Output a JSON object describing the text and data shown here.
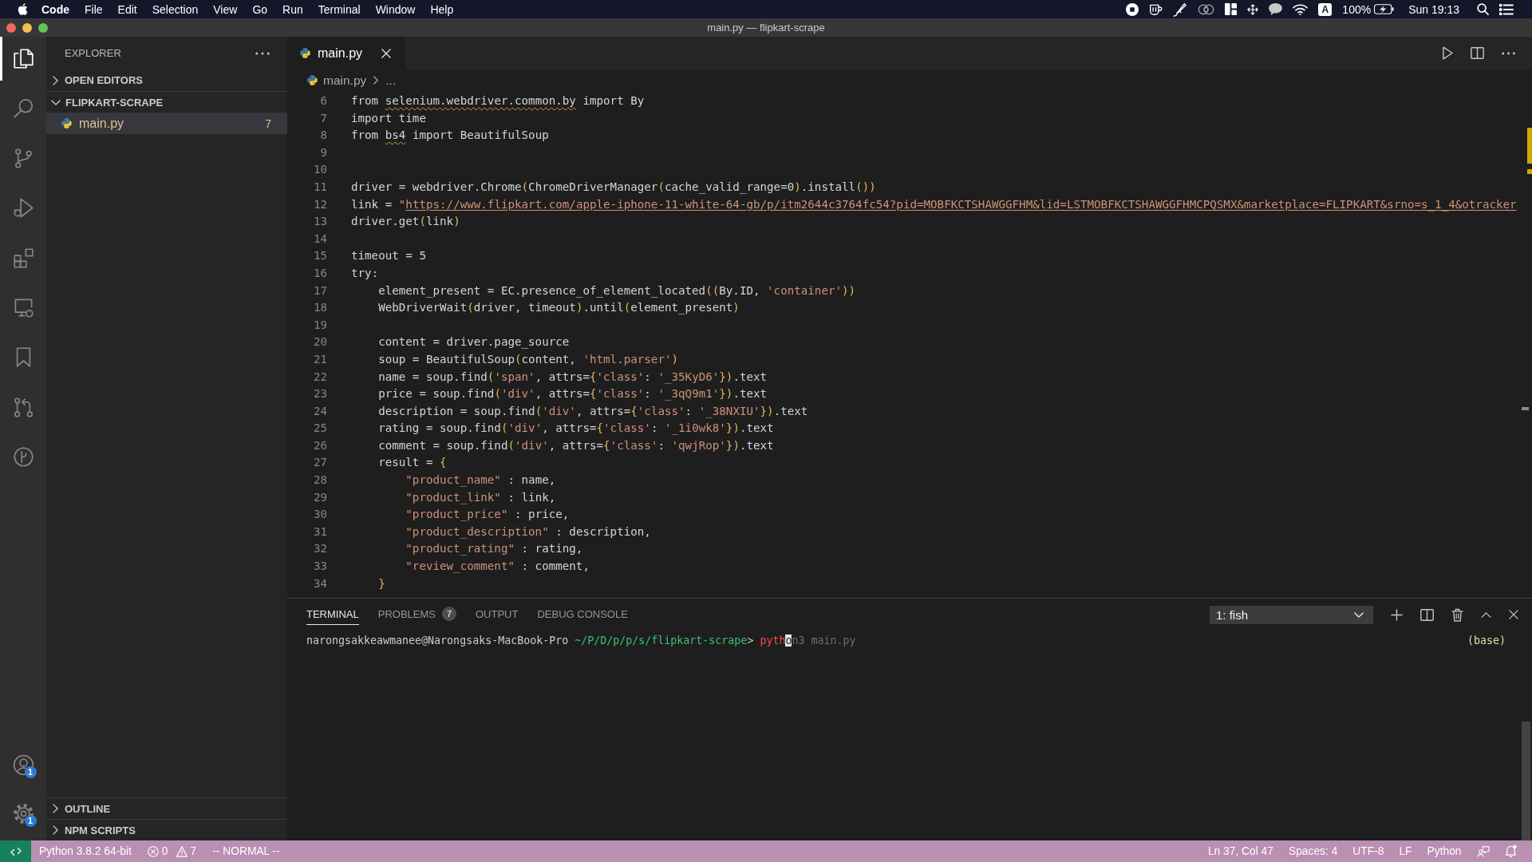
{
  "menu_bar": {
    "app_name": "Code",
    "menus": [
      "File",
      "Edit",
      "Selection",
      "View",
      "Go",
      "Run",
      "Terminal",
      "Window",
      "Help"
    ],
    "input_source": "A",
    "battery": "100%",
    "clock": "Sun 19:13"
  },
  "window": {
    "title": "main.py — flipkart-scrape"
  },
  "activity_bar": {
    "items": [
      {
        "kind": "explorer",
        "selected": true
      },
      {
        "kind": "search",
        "selected": false
      },
      {
        "kind": "source-control",
        "selected": false
      },
      {
        "kind": "run",
        "selected": false
      },
      {
        "kind": "extensions",
        "selected": false
      },
      {
        "kind": "remote",
        "selected": false
      },
      {
        "kind": "bookmarks",
        "selected": false
      },
      {
        "kind": "pull-requests",
        "selected": false
      },
      {
        "kind": "timeline",
        "selected": false
      }
    ],
    "bottom_items": [
      {
        "kind": "accounts",
        "badge": "1"
      },
      {
        "kind": "manage",
        "badge": "1"
      }
    ]
  },
  "sidebar": {
    "title": "EXPLORER",
    "sections": [
      {
        "title": "OPEN EDITORS",
        "expanded": false
      },
      {
        "title": "FLIPKART-SCRAPE",
        "expanded": true,
        "files": [
          {
            "name": "main.py",
            "selected": true,
            "warning": true,
            "problems": "7"
          }
        ]
      },
      {
        "title": "OUTLINE",
        "expanded": false
      },
      {
        "title": "NPM SCRIPTS",
        "expanded": false
      }
    ]
  },
  "editor": {
    "tabs": [
      {
        "label": "main.py",
        "selected": true
      }
    ],
    "breadcrumbs": [
      "main.py",
      "..."
    ],
    "lines": [
      {
        "number": "6",
        "tokens": [
          {
            "text": "from ",
            "kind": "plain"
          },
          {
            "text": "selenium.webdriver.common.by",
            "kind": "squiggle"
          },
          {
            "text": " import By",
            "kind": "plain"
          }
        ]
      },
      {
        "number": "7",
        "tokens": [
          {
            "text": "import time",
            "kind": "plain"
          }
        ]
      },
      {
        "number": "8",
        "tokens": [
          {
            "text": "from ",
            "kind": "plain"
          },
          {
            "text": "bs4",
            "kind": "squiggle"
          },
          {
            "text": " import BeautifulSoup",
            "kind": "plain"
          }
        ]
      },
      {
        "number": "9"
      },
      {
        "number": "10"
      },
      {
        "number": "11",
        "tokens": [
          {
            "text": "driver = webdriver.Chrome",
            "kind": "plain"
          },
          {
            "text": "(",
            "kind": "bracket"
          },
          {
            "text": "ChromeDriverManager",
            "kind": "plain"
          },
          {
            "text": "(",
            "kind": "bracket"
          },
          {
            "text": "cache_valid_range=0",
            "kind": "plain"
          },
          {
            "text": ")",
            "kind": "bracket"
          },
          {
            "text": ".install",
            "kind": "plain"
          },
          {
            "text": "())",
            "kind": "bracket"
          }
        ]
      },
      {
        "number": "12",
        "tokens": [
          {
            "text": "link = ",
            "kind": "plain"
          },
          {
            "text": "\"",
            "kind": "string"
          },
          {
            "text": "https://www.flipkart.com/apple-iphone-11-white-64-gb/p/itm2644c3764fc54?pid=MOBFKCTSHAWGGFHM&lid=LSTMOBFKCTSHAWGGFHMCPQSMX&marketplace=FLIPKART&srno=s_1_4&otracker",
            "kind": "link"
          }
        ]
      },
      {
        "number": "13",
        "tokens": [
          {
            "text": "driver.get",
            "kind": "plain"
          },
          {
            "text": "(",
            "kind": "bracket"
          },
          {
            "text": "link",
            "kind": "plain"
          },
          {
            "text": ")",
            "kind": "bracket"
          }
        ]
      },
      {
        "number": "14"
      },
      {
        "number": "15",
        "tokens": [
          {
            "text": "timeout = 5",
            "kind": "plain"
          }
        ]
      },
      {
        "number": "16",
        "tokens": [
          {
            "text": "try:",
            "kind": "plain"
          }
        ]
      },
      {
        "number": "17",
        "tokens": [
          {
            "text": "    element_present = EC.presence_of_element_located",
            "kind": "plain"
          },
          {
            "text": "((",
            "kind": "bracket"
          },
          {
            "text": "By.ID, ",
            "kind": "plain"
          },
          {
            "text": "'container'",
            "kind": "string"
          },
          {
            "text": "))",
            "kind": "bracket"
          }
        ]
      },
      {
        "number": "18",
        "tokens": [
          {
            "text": "    WebDriverWait",
            "kind": "plain"
          },
          {
            "text": "(",
            "kind": "bracket"
          },
          {
            "text": "driver, timeout",
            "kind": "plain"
          },
          {
            "text": ")",
            "kind": "bracket"
          },
          {
            "text": ".until",
            "kind": "plain"
          },
          {
            "text": "(",
            "kind": "bracket"
          },
          {
            "text": "element_present",
            "kind": "plain"
          },
          {
            "text": ")",
            "kind": "bracket"
          }
        ]
      },
      {
        "number": "19"
      },
      {
        "number": "20",
        "tokens": [
          {
            "text": "    content = driver.page_source",
            "kind": "plain"
          }
        ]
      },
      {
        "number": "21",
        "tokens": [
          {
            "text": "    soup = BeautifulSoup",
            "kind": "plain"
          },
          {
            "text": "(",
            "kind": "bracket"
          },
          {
            "text": "content, ",
            "kind": "plain"
          },
          {
            "text": "'html.parser'",
            "kind": "string"
          },
          {
            "text": ")",
            "kind": "bracket"
          }
        ]
      },
      {
        "number": "22",
        "tokens": [
          {
            "text": "    name = soup.find",
            "kind": "plain"
          },
          {
            "text": "(",
            "kind": "bracket"
          },
          {
            "text": "'span'",
            "kind": "string"
          },
          {
            "text": ", attrs=",
            "kind": "plain"
          },
          {
            "text": "{",
            "kind": "bracket"
          },
          {
            "text": "'class'",
            "kind": "string"
          },
          {
            "text": ": ",
            "kind": "plain"
          },
          {
            "text": "'_35KyD6'",
            "kind": "string"
          },
          {
            "text": "})",
            "kind": "bracket"
          },
          {
            "text": ".text",
            "kind": "plain"
          }
        ]
      },
      {
        "number": "23",
        "tokens": [
          {
            "text": "    price = soup.find",
            "kind": "plain"
          },
          {
            "text": "(",
            "kind": "bracket"
          },
          {
            "text": "'div'",
            "kind": "string"
          },
          {
            "text": ", attrs=",
            "kind": "plain"
          },
          {
            "text": "{",
            "kind": "bracket"
          },
          {
            "text": "'class'",
            "kind": "string"
          },
          {
            "text": ": ",
            "kind": "plain"
          },
          {
            "text": "'_3qQ9m1'",
            "kind": "string"
          },
          {
            "text": "})",
            "kind": "bracket"
          },
          {
            "text": ".text",
            "kind": "plain"
          }
        ]
      },
      {
        "number": "24",
        "tokens": [
          {
            "text": "    description = soup.find",
            "kind": "plain"
          },
          {
            "text": "(",
            "kind": "bracket"
          },
          {
            "text": "'div'",
            "kind": "string"
          },
          {
            "text": ", attrs=",
            "kind": "plain"
          },
          {
            "text": "{",
            "kind": "bracket"
          },
          {
            "text": "'class'",
            "kind": "string"
          },
          {
            "text": ": ",
            "kind": "plain"
          },
          {
            "text": "'_38NXIU'",
            "kind": "string"
          },
          {
            "text": "})",
            "kind": "bracket"
          },
          {
            "text": ".text",
            "kind": "plain"
          }
        ]
      },
      {
        "number": "25",
        "tokens": [
          {
            "text": "    rating = soup.find",
            "kind": "plain"
          },
          {
            "text": "(",
            "kind": "bracket"
          },
          {
            "text": "'div'",
            "kind": "string"
          },
          {
            "text": ", attrs=",
            "kind": "plain"
          },
          {
            "text": "{",
            "kind": "bracket"
          },
          {
            "text": "'class'",
            "kind": "string"
          },
          {
            "text": ": ",
            "kind": "plain"
          },
          {
            "text": "'_1i0wk8'",
            "kind": "string"
          },
          {
            "text": "})",
            "kind": "bracket"
          },
          {
            "text": ".text",
            "kind": "plain"
          }
        ]
      },
      {
        "number": "26",
        "tokens": [
          {
            "text": "    comment = soup.find",
            "kind": "plain"
          },
          {
            "text": "(",
            "kind": "bracket"
          },
          {
            "text": "'div'",
            "kind": "string"
          },
          {
            "text": ", attrs=",
            "kind": "plain"
          },
          {
            "text": "{",
            "kind": "bracket"
          },
          {
            "text": "'class'",
            "kind": "string"
          },
          {
            "text": ": ",
            "kind": "plain"
          },
          {
            "text": "'qwjRop'",
            "kind": "string"
          },
          {
            "text": "})",
            "kind": "bracket"
          },
          {
            "text": ".text",
            "kind": "plain"
          }
        ]
      },
      {
        "number": "27",
        "tokens": [
          {
            "text": "    result = ",
            "kind": "plain"
          },
          {
            "text": "{",
            "kind": "bracket"
          }
        ]
      },
      {
        "number": "28",
        "tokens": [
          {
            "text": "        \"product_name\"",
            "kind": "string"
          },
          {
            "text": " : name,",
            "kind": "plain"
          }
        ]
      },
      {
        "number": "29",
        "tokens": [
          {
            "text": "        \"product_link\"",
            "kind": "string"
          },
          {
            "text": " : link,",
            "kind": "plain"
          }
        ]
      },
      {
        "number": "30",
        "tokens": [
          {
            "text": "        \"product_price\"",
            "kind": "string"
          },
          {
            "text": " : price,",
            "kind": "plain"
          }
        ]
      },
      {
        "number": "31",
        "tokens": [
          {
            "text": "        \"product_description\"",
            "kind": "string"
          },
          {
            "text": " : description,",
            "kind": "plain"
          }
        ]
      },
      {
        "number": "32",
        "tokens": [
          {
            "text": "        \"product_rating\"",
            "kind": "string"
          },
          {
            "text": " : rating,",
            "kind": "plain"
          }
        ]
      },
      {
        "number": "33",
        "tokens": [
          {
            "text": "        \"review_comment\"",
            "kind": "string"
          },
          {
            "text": " : comment,",
            "kind": "plain"
          }
        ]
      },
      {
        "number": "34",
        "tokens": [
          {
            "text": "    }",
            "kind": "bracket"
          }
        ]
      }
    ]
  },
  "panel": {
    "tabs": [
      {
        "label": "TERMINAL",
        "selected": true
      },
      {
        "label": "PROBLEMS",
        "selected": false,
        "count": "7"
      },
      {
        "label": "OUTPUT",
        "selected": false
      },
      {
        "label": "DEBUG CONSOLE",
        "selected": false
      }
    ],
    "terminal_picker": "1: fish",
    "terminal": {
      "segments": [
        {
          "text": "narongsakkeawmanee@Narongsaks-MacBook-Pro",
          "kind": "user"
        },
        {
          "text": " ~/P/D/p/p/s/flipkart-scrape",
          "kind": "path"
        },
        {
          "text": "> ",
          "kind": "plain"
        },
        {
          "text": "pyth",
          "kind": "error"
        },
        {
          "text": "o",
          "kind": "cursor"
        },
        {
          "text": "n3 main.py",
          "kind": "suggestion"
        }
      ],
      "environment": "(base)"
    }
  },
  "status_bar": {
    "interpreter": "Python 3.8.2 64-bit",
    "errors": "0",
    "warnings": "7",
    "mode": "-- NORMAL --",
    "items": [
      "Ln 37, Col 47",
      "Spaces: 4",
      "UTF-8",
      "LF",
      "Python"
    ]
  }
}
